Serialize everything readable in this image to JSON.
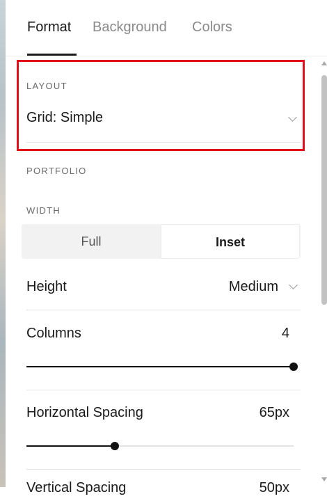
{
  "tabs": [
    {
      "label": "Format",
      "active": true
    },
    {
      "label": "Background",
      "active": false
    },
    {
      "label": "Colors",
      "active": false
    }
  ],
  "layout": {
    "section_label": "LAYOUT",
    "value": "Grid: Simple",
    "chevron_icon": "chevron-down-icon",
    "highlight_color": "#e0101a"
  },
  "portfolio": {
    "section_label": "PORTFOLIO"
  },
  "width": {
    "section_label": "WIDTH",
    "options": [
      "Full",
      "Inset"
    ],
    "selected": "Inset"
  },
  "height": {
    "label": "Height",
    "value": "Medium"
  },
  "columns": {
    "label": "Columns",
    "value": "4",
    "slider_fraction": 1.0
  },
  "horizontal_spacing": {
    "label": "Horizontal Spacing",
    "value": "65px",
    "slider_fraction": 0.33
  },
  "vertical_spacing": {
    "label": "Vertical Spacing",
    "value": "50px"
  }
}
